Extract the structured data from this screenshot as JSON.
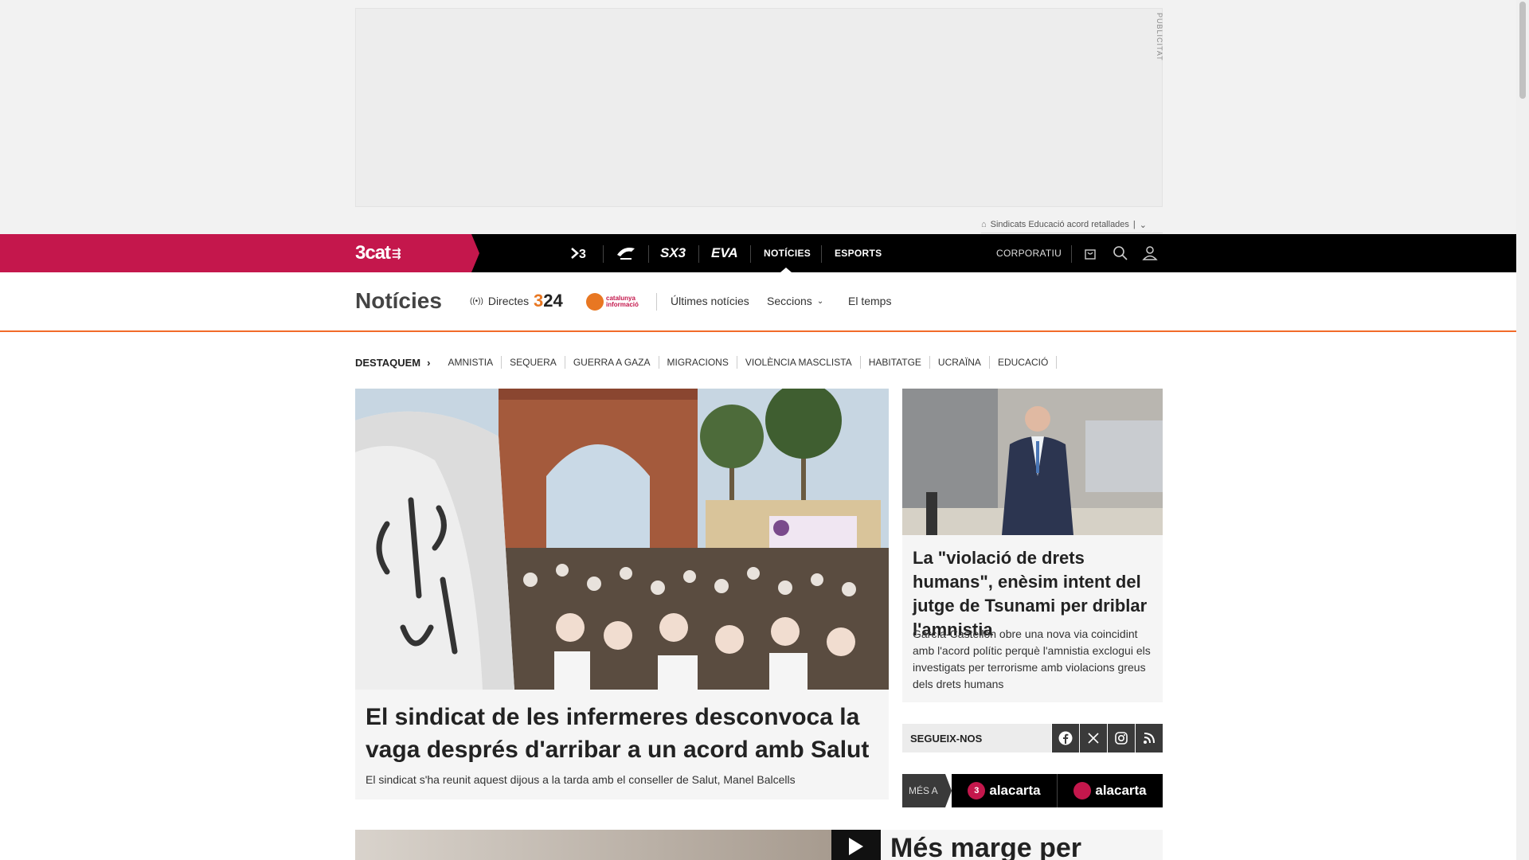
{
  "ad": {
    "label": "PUBLICITAT"
  },
  "topic_bar": {
    "text": "Sindicats Educació acord retallades"
  },
  "topbar": {
    "brand": "3cat",
    "channels": [
      "3",
      "Cat ràdio",
      "SX3",
      "EVA"
    ],
    "nav": [
      {
        "label": "NOTÍCIES",
        "active": true
      },
      {
        "label": "ESPORTS",
        "active": false
      }
    ],
    "corporate": "CORPORATIU"
  },
  "section": {
    "title": "Notícies",
    "directes": "Directes",
    "logo_324": {
      "a": "3",
      "b": "24"
    },
    "logo_ci": {
      "line1": "catalunya",
      "line2": "informació"
    },
    "ultimes": "Últimes notícies",
    "seccions": "Seccions",
    "temps": "El temps"
  },
  "destaquem": {
    "label": "DESTAQUEM",
    "tags": [
      "AMNISTIA",
      "SEQUERA",
      "GUERRA A GAZA",
      "MIGRACIONS",
      "VIOLÈNCIA MASCLISTA",
      "HABITATGE",
      "UCRAÏNA",
      "EDUCACIÓ"
    ]
  },
  "lead_story": {
    "title": "El sindicat de les infermeres desconvoca la vaga després d'arribar a un acord amb Salut",
    "subtitle": "El sindicat s'ha reunit aquest dijous a la tarda amb el conseller de Salut, Manel Balcells"
  },
  "side_story": {
    "title": "La \"violació de drets humans\", enèsim intent del jutge de Tsunami per driblar l'amnistia",
    "subtitle": "García-Castellón obre una nova via coincidint amb l'acord polític perquè l'amnistia exclogui els investigats per terrorisme amb violacions greus dels drets humans"
  },
  "follow": {
    "label": "SEGUEIX-NOS"
  },
  "mes_a": {
    "label": "MÉS A",
    "alacarta": "alacarta"
  },
  "next_story": {
    "title": "Més marge per"
  },
  "colors": {
    "brand": "#c4174c",
    "accent": "#f26b2a",
    "topbar": "#000000"
  }
}
